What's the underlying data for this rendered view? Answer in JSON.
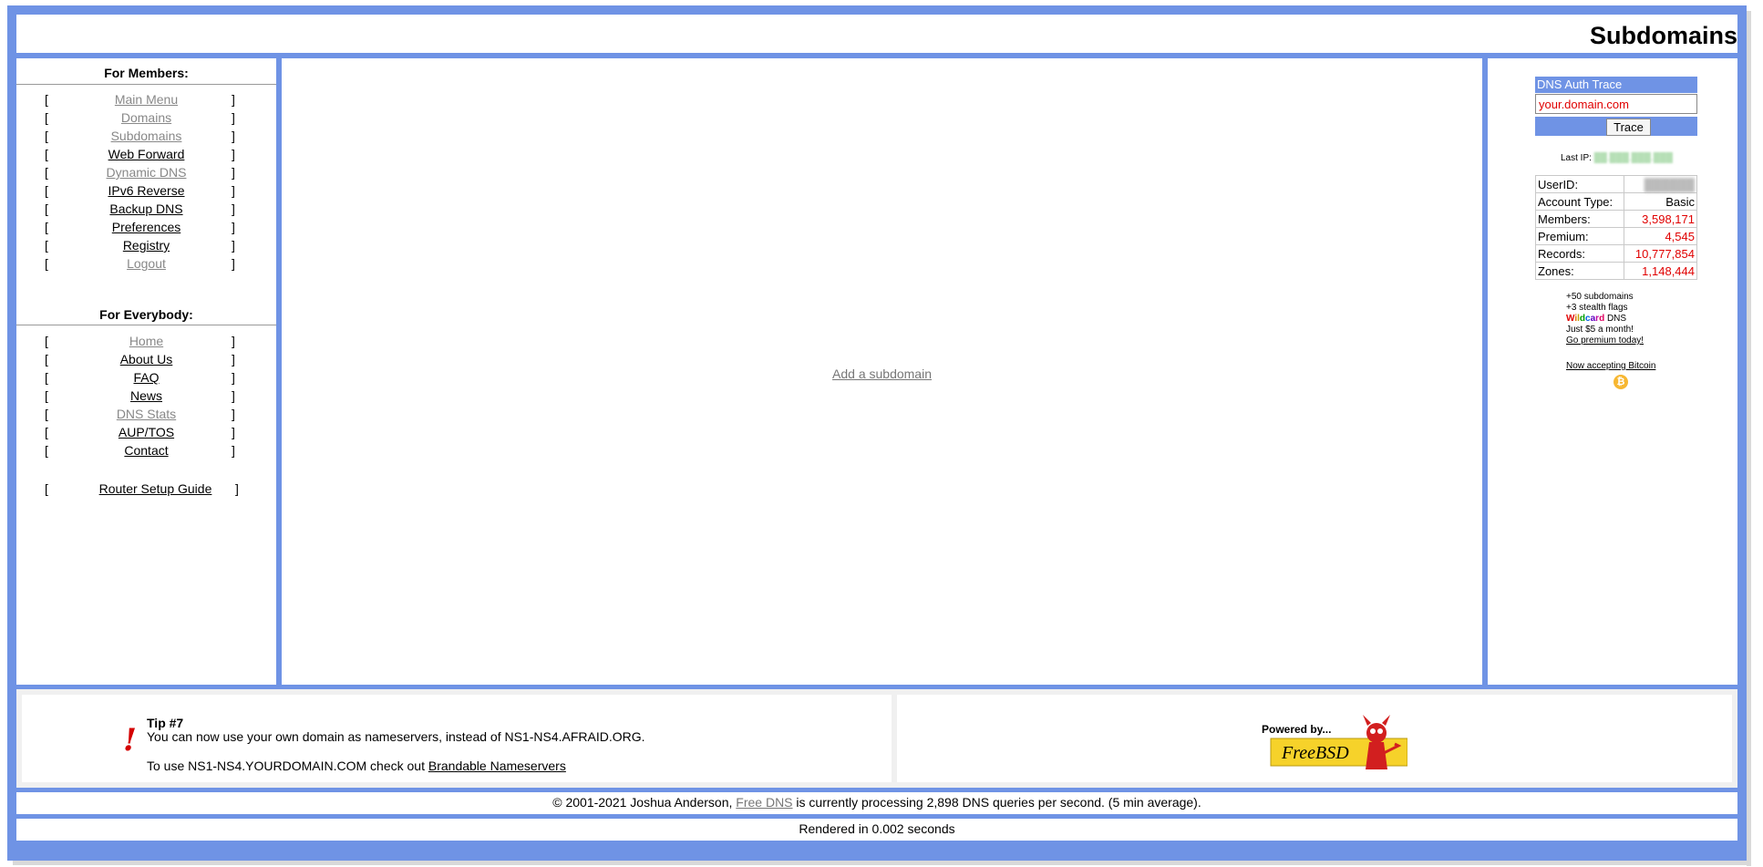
{
  "page": {
    "title": "Subdomains"
  },
  "members": {
    "heading": "For Members:",
    "items": [
      {
        "label": "Main Menu",
        "visited": true
      },
      {
        "label": "Domains",
        "visited": true
      },
      {
        "label": "Subdomains",
        "visited": true
      },
      {
        "label": "Web Forward",
        "visited": false
      },
      {
        "label": "Dynamic DNS",
        "visited": true
      },
      {
        "label": "IPv6 Reverse",
        "visited": false
      },
      {
        "label": "Backup DNS",
        "visited": false
      },
      {
        "label": "Preferences",
        "visited": false
      },
      {
        "label": "Registry",
        "visited": false
      },
      {
        "label": "Logout",
        "visited": true
      }
    ]
  },
  "everybody": {
    "heading": "For Everybody:",
    "items": [
      {
        "label": "Home",
        "visited": true
      },
      {
        "label": "About Us",
        "visited": false
      },
      {
        "label": "FAQ",
        "visited": false
      },
      {
        "label": "News",
        "visited": false
      },
      {
        "label": "DNS Stats",
        "visited": true
      },
      {
        "label": "AUP/TOS",
        "visited": false
      },
      {
        "label": "Contact",
        "visited": false
      }
    ],
    "router_guide": "Router Setup Guide"
  },
  "bracket_open": "[",
  "bracket_close": "]",
  "main": {
    "add_link": "Add a subdomain"
  },
  "trace": {
    "heading": "DNS Auth Trace",
    "placeholder": "your.domain.com",
    "button": "Trace"
  },
  "last_ip": {
    "label": "Last IP:",
    "value": "██.███.███.███"
  },
  "stats": {
    "rows": [
      {
        "key": "UserID:",
        "value": "██████"
      },
      {
        "key": "Account Type:",
        "value": "Basic"
      },
      {
        "key": "Members:",
        "value": "3,598,171"
      },
      {
        "key": "Premium:",
        "value": "4,545"
      },
      {
        "key": "Records:",
        "value": "10,777,854"
      },
      {
        "key": "Zones:",
        "value": "1,148,444"
      }
    ]
  },
  "promo": {
    "line1": "+50 subdomains",
    "line2": "+3 stealth flags",
    "wildcard_word": "Wildcard",
    "wildcard_suffix": " DNS",
    "line4": "Just $5 a month!",
    "cta": "Go premium today!",
    "bitcoin": "Now accepting Bitcoin",
    "bitcoin_symbol": "₿"
  },
  "tip": {
    "title": "Tip #7",
    "text": "You can now use your own domain as nameservers, instead of NS1-NS4.AFRAID.ORG.",
    "text2_prefix": "To use NS1-NS4.YOURDOMAIN.COM check out ",
    "text2_link": "Brandable Nameservers",
    "icon": "!"
  },
  "powered": {
    "line1": "Powered by...",
    "brand": "FreeBSD"
  },
  "footer": {
    "prefix": "© 2001-2021 Joshua Anderson, ",
    "link": "Free DNS",
    "suffix": " is currently processing 2,898 DNS queries per second. (5 min average).",
    "rendered": "Rendered in 0.002 seconds"
  },
  "colors": {
    "frame": "#6f93e5",
    "accent_red": "#e00000",
    "visited_link": "#888888"
  }
}
